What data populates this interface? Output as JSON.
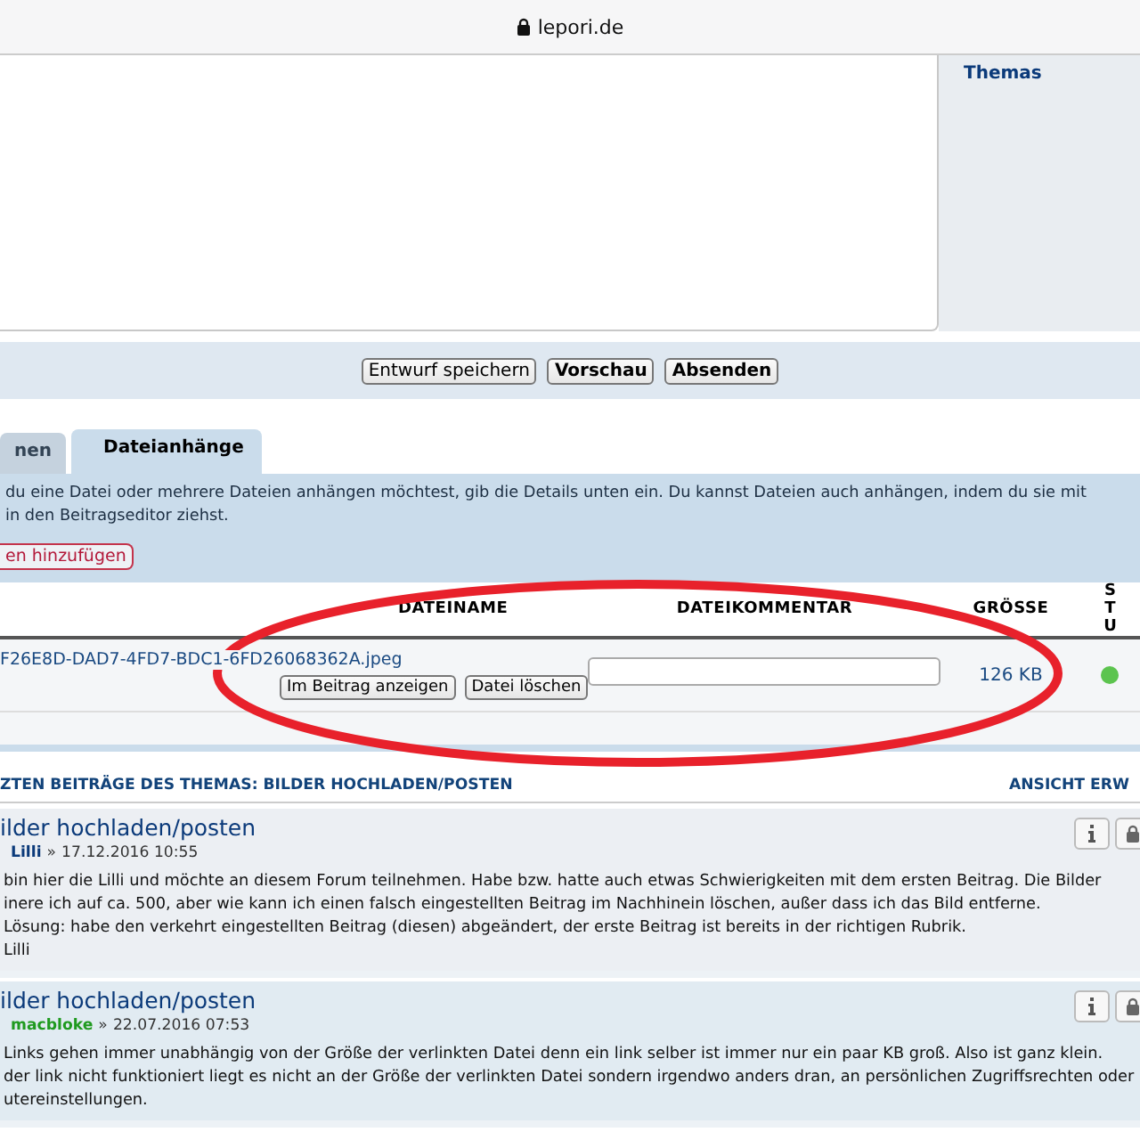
{
  "browser": {
    "address": "lepori.de"
  },
  "sidebar": {
    "link": "Themas"
  },
  "editor_buttons": [
    {
      "label": "Entwurf speichern",
      "primary": false
    },
    {
      "label": "Vorschau",
      "primary": true
    },
    {
      "label": "Absenden",
      "primary": true
    }
  ],
  "tabs": [
    {
      "label": "nen",
      "selected": false
    },
    {
      "label": "Dateianhänge",
      "selected": true
    }
  ],
  "attachments": {
    "intro": [
      "du eine Datei oder mehrere Dateien anhängen möchtest, gib die Details unten ein. Du kannst Dateien auch anhängen, indem du sie mit",
      "in den Beitragseditor ziehst."
    ],
    "add_button": "en hinzufügen",
    "columns": [
      "DATEINAME",
      "DATEIKOMMENTAR",
      "GRÖSSE",
      "ST U"
    ],
    "file": {
      "name": "F26E8D-DAD7-4FD7-BDC1-6FD26068362A.jpeg",
      "buttons": [
        "Im Beitrag anzeigen",
        "Datei löschen"
      ],
      "size": "126 KB"
    }
  },
  "topic_review": {
    "title": "ZTEN BEITRÄGE DES THEMAS: BILDER HOCHLADEN/POSTEN",
    "link": "ANSICHT ERW"
  },
  "posts": [
    {
      "title": "ilder hochladen/posten",
      "author": "Lilli",
      "color": "#0b3a7a",
      "separator": "»",
      "date": "17.12.2016 10:55",
      "lines": [
        "bin hier die Lilli und möchte an diesem Forum teilnehmen. Habe bzw. hatte auch etwas Schwierigkeiten mit dem ersten Beitrag. Die Bilder",
        "inere ich auf ca. 500, aber wie kann ich einen falsch eingestellten Beitrag im Nachhinein löschen, außer dass ich das Bild entferne.",
        "Lösung: habe den verkehrt eingestellten Beitrag (diesen) abgeändert, der erste Beitrag ist bereits in der richtigen Rubrik.",
        "Lilli"
      ]
    },
    {
      "title": "ilder hochladen/posten",
      "author": "macbloke",
      "color": "#1f9a1f",
      "separator": "»",
      "date": "22.07.2016 07:53",
      "lines": [
        "Links gehen immer unabhängig von der Größe der verlinkten Datei denn ein link selber ist immer nur ein paar KB groß. Also ist ganz klein.",
        "der link nicht funktioniert liegt es nicht an der Größe der verlinkten Datei sondern irgendwo anders dran, an persönlichen Zugriffsrechten oder",
        "utereinstellungen."
      ]
    }
  ]
}
